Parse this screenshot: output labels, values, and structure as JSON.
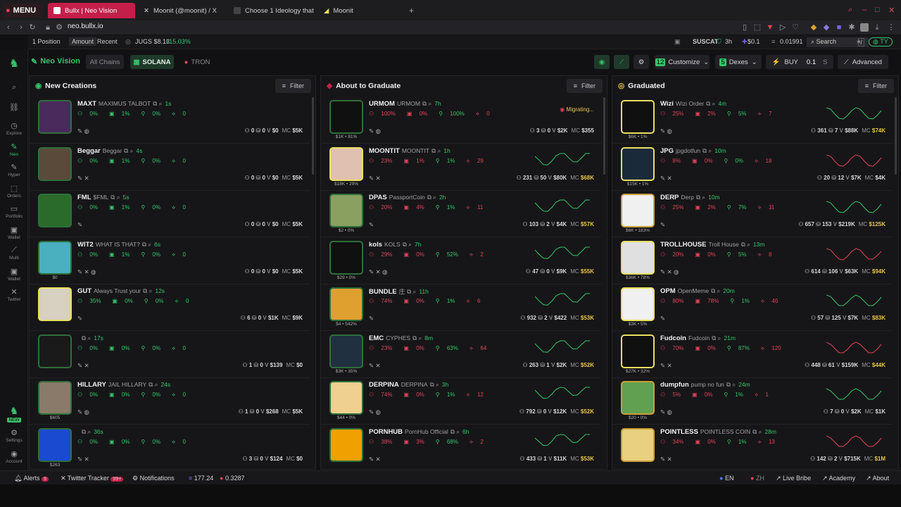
{
  "browser": {
    "menu_label": "MENU",
    "tabs": [
      {
        "label": "Bullx | Neo Vision",
        "active": true
      },
      {
        "label": "Moonit (@moonit) / X",
        "active": false
      },
      {
        "label": "Choose 1 Ideology that yo",
        "active": false
      },
      {
        "label": "Moonit",
        "active": false
      }
    ],
    "url": "neo.bullx.io"
  },
  "topstrip": {
    "position": "1 Position",
    "amount": "Amount",
    "recent": "Recent",
    "token": "JUGS $8.13",
    "token_change": "+15.03%",
    "watch_name": "SUSCAT",
    "watch_age": "3h",
    "watch_price": "$0.1",
    "balance": "0.01991",
    "search_label": "Search",
    "search_key": "/",
    "profile": "TY"
  },
  "nav": {
    "items": [
      {
        "label": "Explore",
        "icon": "clock-icon"
      },
      {
        "label": "Neo",
        "icon": "leaf-icon"
      },
      {
        "label": "Hyper",
        "icon": "lightning-icon"
      },
      {
        "label": "Orders",
        "icon": "orders-icon"
      },
      {
        "label": "Portfolio",
        "icon": "briefcase-icon"
      },
      {
        "label": "Wallet",
        "icon": "wallet-icon"
      },
      {
        "label": "Multi",
        "icon": "chart-icon"
      },
      {
        "label": "Wallet",
        "icon": "wallet-icon"
      },
      {
        "label": "Twitter",
        "icon": "x-icon"
      }
    ],
    "new_badge": "NEW",
    "settings": "Settings",
    "account": "Account"
  },
  "header": {
    "title": "Neo Vision",
    "chains": [
      {
        "label": "All Chains",
        "active": false
      },
      {
        "label": "SOLANA",
        "active": true
      },
      {
        "label": "TRON",
        "active": false
      }
    ],
    "customize_count": "12",
    "customize_label": "Customize",
    "dexes_count": "5",
    "dexes_label": "Dexes",
    "buy_label": "BUY",
    "buy_amount": "0.1",
    "buy_unit": "S",
    "advanced_label": "Advanced"
  },
  "panels": [
    {
      "title": "New Creations",
      "filter": "Filter",
      "cards": [
        {
          "symbol": "MAXT",
          "name": "MAXIMUS TALBOT",
          "age": "1s",
          "pcts": [
            "0%",
            "1%",
            "0%",
            "0"
          ],
          "sub": "",
          "holders": "0",
          "txs": "0",
          "vol": "$0",
          "mc": "$5K",
          "img": "#4a2a5c",
          "mcy": false
        },
        {
          "symbol": "Beggar",
          "name": "Beggar",
          "age": "4s",
          "pcts": [
            "0%",
            "1%",
            "0%",
            "0"
          ],
          "sub": "",
          "holders": "0",
          "txs": "0",
          "vol": "$0",
          "mc": "$5K",
          "img": "#5a4a3a",
          "mcy": false
        },
        {
          "symbol": "FML",
          "name": "$FML",
          "age": "5s",
          "pcts": [
            "0%",
            "1%",
            "0%",
            "0"
          ],
          "sub": "",
          "holders": "0",
          "txs": "0",
          "vol": "$0",
          "mc": "$5K",
          "img": "#2a6a2a",
          "mcy": false
        },
        {
          "symbol": "WIT2",
          "name": "WHAT IS THAT?",
          "age": "6s",
          "pcts": [
            "0%",
            "1%",
            "0%",
            "0"
          ],
          "sub": "$0",
          "holders": "0",
          "txs": "0",
          "vol": "$0",
          "mc": "$5K",
          "img": "#4ab0c0",
          "mcy": false
        },
        {
          "symbol": "GUT",
          "name": "Always Trust your",
          "age": "12s",
          "pcts": [
            "35%",
            "0%",
            "0%",
            "0"
          ],
          "sub": "",
          "holders": "6",
          "txs": "0",
          "vol": "$1K",
          "mc": "$9K",
          "img": "#d8d0c0",
          "mcy": false
        },
        {
          "symbol": "",
          "name": "",
          "age": "17s",
          "pcts": [
            "0%",
            "0%",
            "0%",
            "0"
          ],
          "sub": "",
          "holders": "1",
          "txs": "0",
          "vol": "$139",
          "mc": "$0",
          "img": "#1a1a1a",
          "mcy": false
        },
        {
          "symbol": "HILLARY",
          "name": "JAIL HILLARY",
          "age": "24s",
          "pcts": [
            "0%",
            "0%",
            "0%",
            "0"
          ],
          "sub": "$605",
          "holders": "1",
          "txs": "0",
          "vol": "$268",
          "mc": "$5K",
          "img": "#8a7a6a",
          "mcy": false
        },
        {
          "symbol": "",
          "name": "",
          "age": "36s",
          "pcts": [
            "0%",
            "0%",
            "0%",
            "0"
          ],
          "sub": "$263",
          "holders": "3",
          "txs": "0",
          "vol": "$124",
          "mc": "$0",
          "img": "#1a4ad0",
          "mcy": false
        }
      ]
    },
    {
      "title": "About to Graduate",
      "filter": "Filter",
      "cards": [
        {
          "symbol": "URMOM",
          "name": "URMOM",
          "age": "7h",
          "pcts": [
            "100%",
            "0%",
            "100%",
            "0"
          ],
          "sub": "$1K  • 81%",
          "holders": "3",
          "txs": "0",
          "vol": "$2K",
          "mc": "$355",
          "img": "#101010",
          "mcy": false,
          "status": "Migrating..."
        },
        {
          "symbol": "MOONTIT",
          "name": "MOONTIT",
          "age": "1h",
          "pcts": [
            "23%",
            "1%",
            "1%",
            "29"
          ],
          "sub": "$18K  • 29%",
          "holders": "231",
          "txs": "50",
          "vol": "$80K",
          "mc": "$68K",
          "img": "#e0c0b0",
          "mcy": true
        },
        {
          "symbol": "DPAS",
          "name": "PassportCoin",
          "age": "2h",
          "pcts": [
            "20%",
            "4%",
            "1%",
            "11"
          ],
          "sub": "$2  • 0%",
          "holders": "103",
          "txs": "2",
          "vol": "$4K",
          "mc": "$57K",
          "img": "#8aa060",
          "mcy": true
        },
        {
          "symbol": "kols",
          "name": "KOLS",
          "age": "7h",
          "pcts": [
            "29%",
            "0%",
            "52%",
            "2"
          ],
          "sub": "$29  • 0%",
          "holders": "47",
          "txs": "0",
          "vol": "$9K",
          "mc": "$55K",
          "img": "#101010",
          "mcy": true
        },
        {
          "symbol": "BUNDLE",
          "name": "庄",
          "age": "11h",
          "pcts": [
            "74%",
            "0%",
            "1%",
            "6"
          ],
          "sub": "$4  • 542%",
          "holders": "932",
          "txs": "2",
          "vol": "$422",
          "mc": "$53K",
          "img": "#e0a030",
          "mcy": true
        },
        {
          "symbol": "EMC",
          "name": "CYPHES",
          "age": "8m",
          "pcts": [
            "23%",
            "0%",
            "63%",
            "64"
          ],
          "sub": "$3K  • 35%",
          "holders": "263",
          "txs": "1",
          "vol": "$2K",
          "mc": "$52K",
          "img": "#203040",
          "mcy": true
        },
        {
          "symbol": "DERPINA",
          "name": "DERPINA",
          "age": "3h",
          "pcts": [
            "74%",
            "0%",
            "1%",
            "12"
          ],
          "sub": "$44  • 0%",
          "holders": "792",
          "txs": "0",
          "vol": "$12K",
          "mc": "$52K",
          "img": "#f0d090",
          "mcy": true
        },
        {
          "symbol": "PORNHUB",
          "name": "PornHub Official",
          "age": "6h",
          "pcts": [
            "38%",
            "3%",
            "68%",
            "2"
          ],
          "sub": "",
          "holders": "433",
          "txs": "1",
          "vol": "$11K",
          "mc": "$53K",
          "img": "#f0a000",
          "mcy": true
        }
      ]
    },
    {
      "title": "Graduated",
      "filter": "Filter",
      "cards": [
        {
          "symbol": "Wizi",
          "name": "Wizi Order",
          "age": "4m",
          "pcts": [
            "25%",
            "2%",
            "5%",
            "7"
          ],
          "sub": "$6K  • 1%",
          "holders": "361",
          "txs": "7",
          "vol": "$88K",
          "mc": "$74K",
          "img": "#101010",
          "mcy": true
        },
        {
          "symbol": "JPG",
          "name": "jpgdotfun",
          "age": "10m",
          "pcts": [
            "8%",
            "0%",
            "0%",
            "18"
          ],
          "sub": "$15K  • 1%",
          "holders": "20",
          "txs": "12",
          "vol": "$7K",
          "mc": "$4K",
          "img": "#1a2a3a",
          "mcy": false
        },
        {
          "symbol": "DERP",
          "name": "Derp",
          "age": "10m",
          "pcts": [
            "25%",
            "2%",
            "7%",
            "11"
          ],
          "sub": "$6K  • 183%",
          "holders": "657",
          "txs": "153",
          "vol": "$219K",
          "mc": "$125K",
          "img": "#f0f0f0",
          "mcy": true
        },
        {
          "symbol": "TROLLHOUSE",
          "name": "Troll House",
          "age": "13m",
          "pcts": [
            "20%",
            "0%",
            "5%",
            "8"
          ],
          "sub": "$36K  • 78%",
          "holders": "614",
          "txs": "106",
          "vol": "$63K",
          "mc": "$94K",
          "img": "#e0e0e0",
          "mcy": true
        },
        {
          "symbol": "OPM",
          "name": "OpenMeme",
          "age": "20m",
          "pcts": [
            "80%",
            "78%",
            "1%",
            "46"
          ],
          "sub": "$3K  • 5%",
          "holders": "57",
          "txs": "125",
          "vol": "$7K",
          "mc": "$83K",
          "img": "#f0f0f0",
          "mcy": true
        },
        {
          "symbol": "Fudcoin",
          "name": "Fudcoin",
          "age": "21m",
          "pcts": [
            "70%",
            "0%",
            "87%",
            "120"
          ],
          "sub": "$27K  • 32%",
          "holders": "448",
          "txs": "61",
          "vol": "$159K",
          "mc": "$44K",
          "img": "#101010",
          "mcy": true
        },
        {
          "symbol": "dumpfun",
          "name": "pump no fun",
          "age": "24m",
          "pcts": [
            "5%",
            "0%",
            "1%",
            "1"
          ],
          "sub": "$20  • 0%",
          "holders": "7",
          "txs": "0",
          "vol": "$2K",
          "mc": "$1K",
          "img": "#60a050",
          "mcy": false
        },
        {
          "symbol": "POINTLESS",
          "name": "POINTLESS COIN",
          "age": "28m",
          "pcts": [
            "34%",
            "0%",
            "1%",
            "13"
          ],
          "sub": "",
          "holders": "142",
          "txs": "2",
          "vol": "$715K",
          "mc": "$1M",
          "img": "#e8d080",
          "mcy": true
        }
      ]
    }
  ],
  "bottom": {
    "alerts": "Alerts",
    "alerts_count": "9",
    "tracker": "Twitter Tracker",
    "tracker_count": "99+",
    "notifications": "Notifications",
    "sol_price": "177.24",
    "tron_price": "0.3287",
    "lang_en": "EN",
    "lang_zh": "ZH",
    "live_bribe": "Live Bribe",
    "academy": "Academy",
    "about": "About"
  },
  "colors": {
    "accent": "#c41f4a",
    "green": "#37c46a",
    "red": "#e0445a",
    "yellow": "#e8c547"
  }
}
